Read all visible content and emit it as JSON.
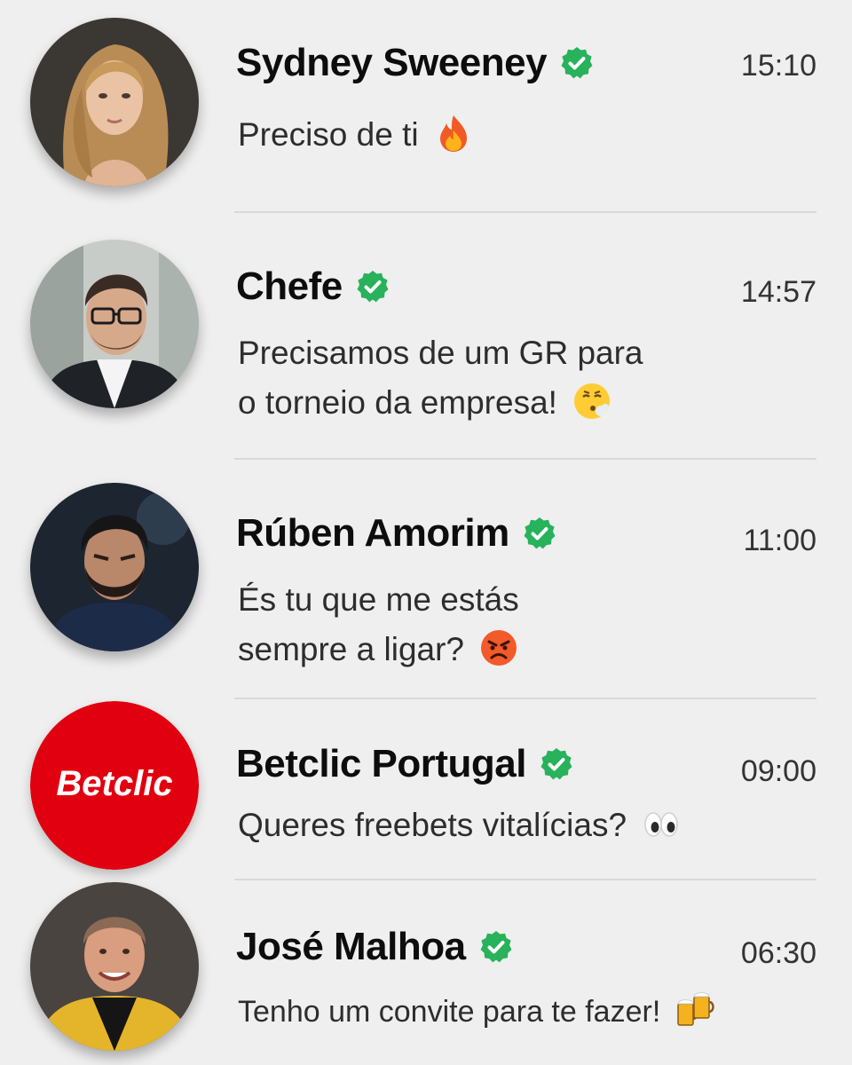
{
  "chats": [
    {
      "name": "Sydney Sweeney",
      "time": "15:10",
      "line1": "Preciso de ti",
      "line2": "",
      "emoji": "fire-emoji",
      "avatar": "avatar-blonde-woman"
    },
    {
      "name": "Chefe",
      "time": "14:57",
      "line1": "Precisamos de um GR para",
      "line2": "o torneio da empresa!",
      "emoji": "exhaling-face-emoji",
      "avatar": "avatar-man-glasses-suit"
    },
    {
      "name": "Rúben Amorim",
      "time": "11:00",
      "line1": "És tu que me estás",
      "line2": "sempre a ligar?",
      "emoji": "angry-face-emoji",
      "avatar": "avatar-bearded-man"
    },
    {
      "name": "Betclic Portugal",
      "time": "09:00",
      "line1": "Queres freebets vitalícias?",
      "line2": "",
      "emoji": "eyes-emoji",
      "avatar": "betclic-logo"
    },
    {
      "name": "José Malhoa",
      "time": "06:30",
      "line1": "Tenho um convite para te fazer!",
      "line2": "",
      "emoji": "beer-mugs-emoji",
      "avatar": "avatar-man-yellow-jacket"
    }
  ],
  "logo_text": "Betclic",
  "colors": {
    "verified": "#27b25b",
    "betclic_red": "#e1000f",
    "background": "#efefef"
  }
}
